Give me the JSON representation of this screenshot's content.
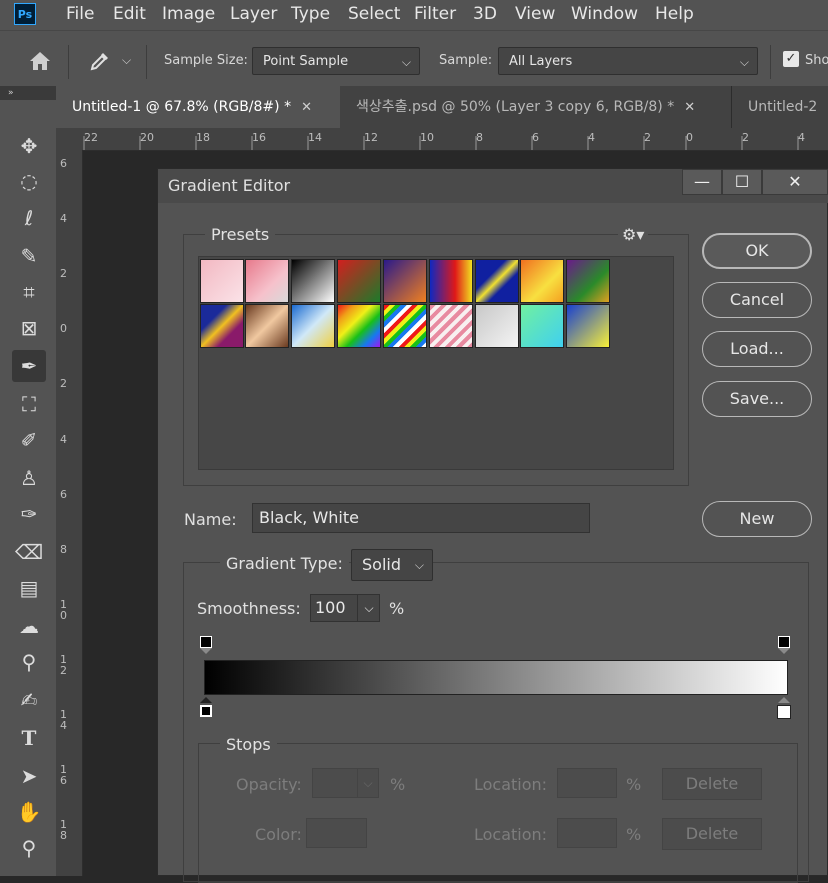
{
  "app": {
    "logo_text": "Ps"
  },
  "menu": [
    "File",
    "Edit",
    "Image",
    "Layer",
    "Type",
    "Select",
    "Filter",
    "3D",
    "View",
    "Window",
    "Help"
  ],
  "options": {
    "sample_size_label": "Sample Size:",
    "sample_size_value": "Point Sample",
    "sample_label": "Sample:",
    "sample_value": "All Layers",
    "show_label": "Sho",
    "show_checked": true
  },
  "tabs": [
    {
      "label": "Untitled-1 @ 67.8% (RGB/8#) *",
      "active": true
    },
    {
      "label": "색상추출.psd @ 50% (Layer 3 copy 6, RGB/8) *",
      "active": false
    },
    {
      "label": "Untitled-2",
      "active": false
    }
  ],
  "ruler": {
    "h_labels": [
      "22",
      "20",
      "18",
      "16",
      "14",
      "12",
      "10",
      "8",
      "6",
      "4",
      "2",
      "0",
      "2",
      "4"
    ],
    "v_labels": [
      "6",
      "4",
      "2",
      "0",
      "2",
      "4",
      "6",
      "8",
      "1\n0",
      "1\n2",
      "1\n4",
      "1\n6",
      "1\n8"
    ]
  },
  "tools": [
    "move-tool",
    "lasso-tool",
    "quick-select-tool",
    "crop-tool",
    "frame-tool",
    "eyedropper-tool",
    "patch-tool",
    "brush-tool",
    "clone-stamp-tool",
    "history-brush-tool",
    "eraser-tool",
    "gradient-tool",
    "blur-tool",
    "dodge-tool",
    "pen-tool",
    "type-tool",
    "path-select-tool",
    "hand-tool",
    "zoom-tool"
  ],
  "dialog": {
    "title": "Gradient Editor",
    "presets_label": "Presets",
    "buttons": {
      "ok": "OK",
      "cancel": "Cancel",
      "load": "Load...",
      "save": "Save...",
      "new": "New"
    },
    "name_label": "Name:",
    "name_value": "Black, White",
    "gradient_type_label": "Gradient Type:",
    "gradient_type_value": "Solid",
    "smoothness_label": "Smoothness:",
    "smoothness_value": "100",
    "smoothness_unit": "%",
    "gradient": {
      "from": "#000000",
      "to": "#ffffff"
    },
    "stops": {
      "group_label": "Stops",
      "opacity_label": "Opacity:",
      "color_label": "Color:",
      "location_label": "Location:",
      "percent": "%",
      "delete_label": "Delete"
    },
    "presets": [
      "linear-gradient(135deg,#f2b8c2,#fbe3e8)",
      "linear-gradient(135deg,#e77a8c,#f6c1cb 60%,#d9d9d9)",
      "linear-gradient(135deg,#000000,#ffffff)",
      "linear-gradient(135deg,#d21f1f,#1d7a2a)",
      "linear-gradient(135deg,#2a1a8a,#f08020)",
      "linear-gradient(90deg,#1028c0,#e01818 60%,#f0e020)",
      "linear-gradient(135deg,#1020a0 35%,#f0e030 50%,#1020a0 65%)",
      "linear-gradient(135deg,#f07020,#f8e040 60%,#f4a020)",
      "linear-gradient(135deg,#6a1a8a,#2a8a2a 60%,#e0a020)",
      "linear-gradient(135deg,#1a2a9a 30%,#f0c020 50%,#8a1a6a 70%)",
      "linear-gradient(135deg,#6a3a20,#f0c8a0 50%,#6a3a20)",
      "linear-gradient(135deg,#1a6ad0,#d0e8f8 50%,#f0d040)",
      "linear-gradient(135deg,#f01818,#f0a018,#f0f018,#18c018,#1878f0,#a018f0)",
      "repeating-linear-gradient(135deg,#f01818 0 4px,#f0f018 4px 8px,#18c018 8px 12px,#1878f0 12px 16px,#fff 16px 20px)",
      "repeating-linear-gradient(135deg,#e88aa0 0 4px,#f8f0f0 4px 8px)",
      "linear-gradient(135deg,#c8c8c8,#f4f4f4)",
      "linear-gradient(135deg,#70f0a0,#40d0f0)",
      "linear-gradient(135deg,#1840d0,#f8f038)"
    ]
  }
}
